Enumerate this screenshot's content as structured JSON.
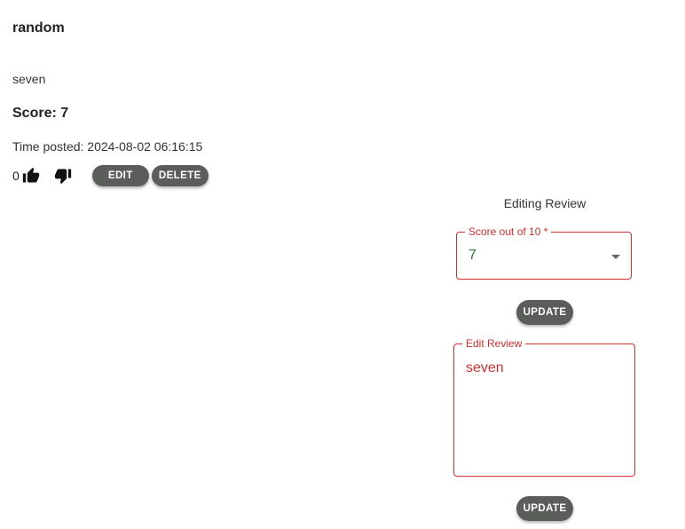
{
  "review": {
    "title": "random",
    "body": "seven",
    "score_text": "Score: 7",
    "time_posted": "Time posted: 2024-08-02 06:16:15",
    "like_count": "0"
  },
  "actions": {
    "edit_label": "EDIT",
    "delete_label": "DELETE"
  },
  "edit_panel": {
    "title": "Editing Review",
    "score_field": {
      "label": "Score out of 10 *",
      "value": "7"
    },
    "update_label": "UPDATE",
    "review_field": {
      "label": "Edit Review",
      "value": "seven"
    },
    "update_label_2": "UPDATE"
  },
  "colors": {
    "error": "#d32f2f",
    "button_bg": "#5a5d5a",
    "select_value": "#2e7d32"
  },
  "icons": {
    "like": "thumb-up-icon",
    "dislike": "thumb-down-icon",
    "dropdown": "arrow-drop-down-icon"
  }
}
